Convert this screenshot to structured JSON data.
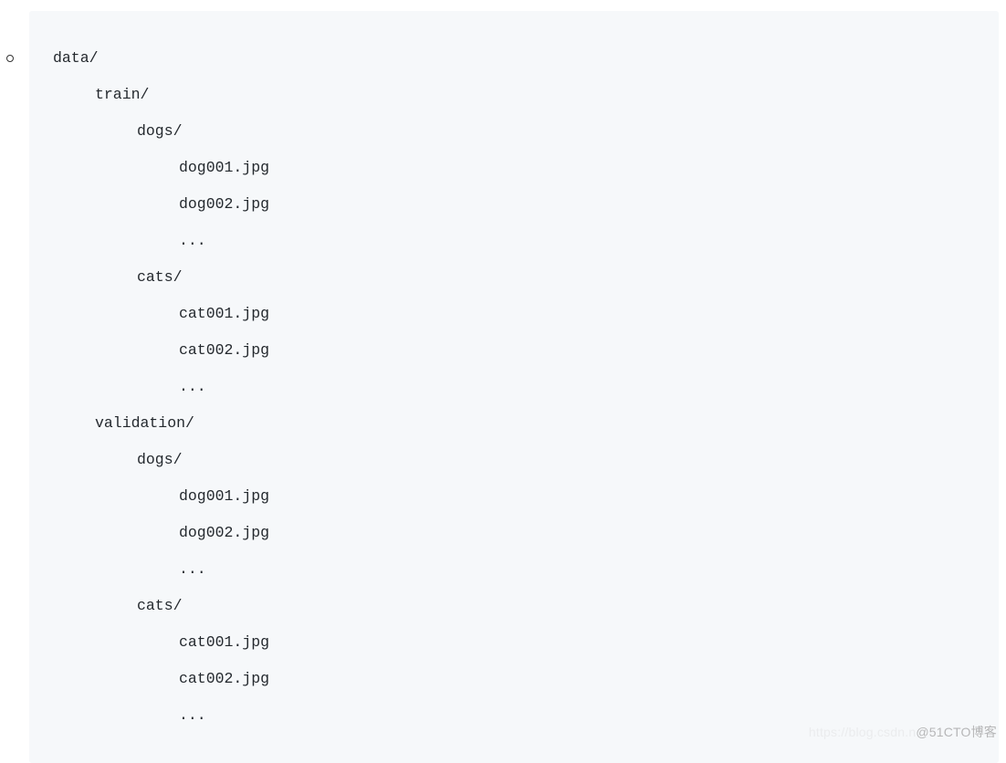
{
  "code": {
    "lines": [
      {
        "indent": 0,
        "text": "data/"
      },
      {
        "indent": 1,
        "text": "train/"
      },
      {
        "indent": 2,
        "text": "dogs/"
      },
      {
        "indent": 3,
        "text": "dog001.jpg"
      },
      {
        "indent": 3,
        "text": "dog002.jpg"
      },
      {
        "indent": 3,
        "text": "..."
      },
      {
        "indent": 2,
        "text": "cats/"
      },
      {
        "indent": 3,
        "text": "cat001.jpg"
      },
      {
        "indent": 3,
        "text": "cat002.jpg"
      },
      {
        "indent": 3,
        "text": "..."
      },
      {
        "indent": 1,
        "text": "validation/"
      },
      {
        "indent": 2,
        "text": "dogs/"
      },
      {
        "indent": 3,
        "text": "dog001.jpg"
      },
      {
        "indent": 3,
        "text": "dog002.jpg"
      },
      {
        "indent": 3,
        "text": "..."
      },
      {
        "indent": 2,
        "text": "cats/"
      },
      {
        "indent": 3,
        "text": "cat001.jpg"
      },
      {
        "indent": 3,
        "text": "cat002.jpg"
      },
      {
        "indent": 3,
        "text": "..."
      }
    ]
  },
  "watermark": {
    "faint": "https://blog.csdn.n",
    "main": "@51CTO博客"
  }
}
